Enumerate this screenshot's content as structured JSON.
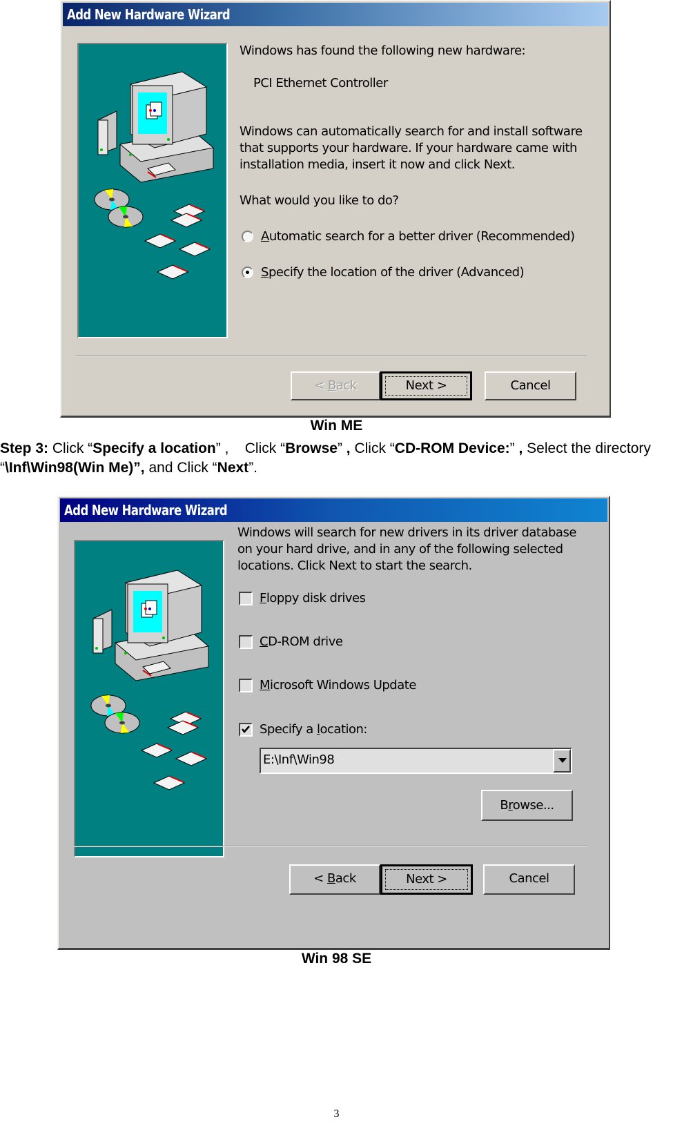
{
  "dialog_me": {
    "title": "Add New Hardware Wizard",
    "found_label": "Windows has found the following new hardware:",
    "device_name": "PCI Ethernet Controller",
    "description_lines": [
      "Windows can automatically search for and install software",
      "that supports your hardware. If your hardware came with",
      "installation media, insert it now and click Next."
    ],
    "question": "What would you like to do?",
    "options": [
      {
        "mnemonic": "A",
        "rest": "utomatic search for a better driver (Recommended)",
        "selected": false
      },
      {
        "mnemonic": "S",
        "rest": "pecify the location of the driver (Advanced)",
        "selected": true
      }
    ],
    "buttons": {
      "back_prefix": "< ",
      "back_mnemonic": "B",
      "back_rest": "ack",
      "next": "Next >",
      "cancel": "Cancel"
    },
    "caption": "Win ME"
  },
  "instructions": {
    "step_label": "Step 3:",
    "parts": [
      " Click “",
      "Specify a location",
      "” ,    Click “",
      "Browse",
      "” ",
      ",",
      " Click “",
      "CD-ROM Device:",
      "” ",
      ",",
      " Select the directory “",
      "\\Inf\\Win98(Win Me)",
      "”,",
      " and Click “",
      "Next",
      "”."
    ]
  },
  "dialog_98": {
    "title": "Add New Hardware Wizard",
    "description_lines": [
      "Windows will search for new drivers in its driver database",
      "on your hard drive, and in any of the following selected",
      "locations. Click Next to start the search."
    ],
    "checkboxes": [
      {
        "pre": "",
        "mnemonic": "F",
        "rest": "loppy disk drives",
        "checked": false
      },
      {
        "pre": "",
        "mnemonic": "C",
        "rest": "D-ROM drive",
        "checked": false
      },
      {
        "pre": "",
        "mnemonic": "M",
        "rest": "icrosoft Windows Update",
        "checked": false
      },
      {
        "pre": "Specify a ",
        "mnemonic": "l",
        "rest": "ocation:",
        "checked": true
      }
    ],
    "location_value": "E:\\Inf\\Win98",
    "browse": {
      "pre": "B",
      "mnemonic": "r",
      "rest": "owse..."
    },
    "buttons": {
      "back_prefix": "< ",
      "back_mnemonic": "B",
      "back_rest": "ack",
      "next": "Next >",
      "cancel": "Cancel"
    },
    "caption": "Win 98 SE"
  },
  "page_number": "3",
  "colors": {
    "teal_art": "#008080",
    "me_face": "#d4d0c8",
    "w98_face": "#c0c0c0",
    "title_dark": "#0a246a",
    "title_98": "#000080"
  }
}
